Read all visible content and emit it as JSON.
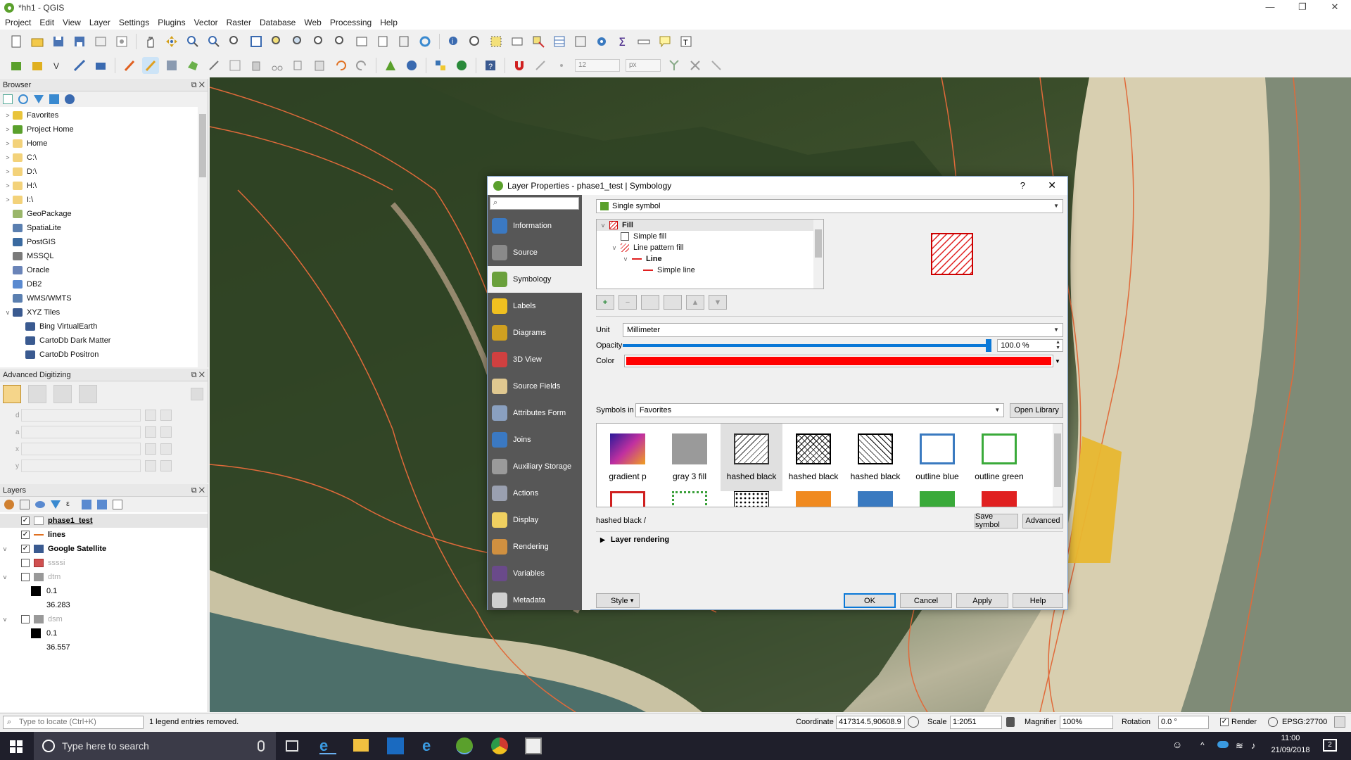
{
  "window": {
    "title": "*hh1 - QGIS",
    "minimize": "—",
    "restore": "❐",
    "close": "✕"
  },
  "menu": [
    "Project",
    "Edit",
    "View",
    "Layer",
    "Settings",
    "Plugins",
    "Vector",
    "Raster",
    "Database",
    "Web",
    "Processing",
    "Help"
  ],
  "toolbar2": {
    "snap_tolerance": "12",
    "snap_unit": "px"
  },
  "browser": {
    "title": "Browser",
    "items": [
      {
        "label": "Favorites",
        "icon": "star-icon",
        "color": "#e9c43b"
      },
      {
        "label": "Project Home",
        "icon": "folder-icon",
        "color": "#5aa02c"
      },
      {
        "label": "Home",
        "icon": "folder-icon",
        "color": "#f3d27a"
      },
      {
        "label": "C:\\",
        "icon": "folder-icon",
        "color": "#f3d27a"
      },
      {
        "label": "D:\\",
        "icon": "folder-icon",
        "color": "#f3d27a"
      },
      {
        "label": "H:\\",
        "icon": "folder-icon",
        "color": "#f3d27a"
      },
      {
        "label": "I:\\",
        "icon": "folder-icon",
        "color": "#f3d27a"
      },
      {
        "label": "GeoPackage",
        "icon": "geopackage-icon",
        "color": "#9ab66a"
      },
      {
        "label": "SpatiaLite",
        "icon": "spatialite-icon",
        "color": "#5a7fb0"
      },
      {
        "label": "PostGIS",
        "icon": "postgis-icon",
        "color": "#3a6aa0"
      },
      {
        "label": "MSSQL",
        "icon": "mssql-icon",
        "color": "#7a7a7a"
      },
      {
        "label": "Oracle",
        "icon": "oracle-icon",
        "color": "#6a84b8"
      },
      {
        "label": "DB2",
        "icon": "db2-icon",
        "color": "#5a8ad0"
      },
      {
        "label": "WMS/WMTS",
        "icon": "wms-icon",
        "color": "#5a7fb0"
      },
      {
        "label": "XYZ Tiles",
        "icon": "xyz-icon",
        "color": "#3a5a90"
      },
      {
        "label": "Bing VirtualEarth",
        "icon": "tile-icon",
        "color": "#3a5a90"
      },
      {
        "label": "CartoDb Dark Matter",
        "icon": "tile-icon",
        "color": "#3a5a90"
      },
      {
        "label": "CartoDb Positron",
        "icon": "tile-icon",
        "color": "#3a5a90"
      }
    ]
  },
  "advdig": {
    "title": "Advanced Digitizing",
    "rows": [
      "d",
      "a",
      "x",
      "y"
    ]
  },
  "layers": {
    "title": "Layers",
    "items": [
      {
        "label": "phase1_test",
        "checked": "✓",
        "bold": true
      },
      {
        "label": "lines",
        "checked": "✓",
        "bold": true
      },
      {
        "label": "Google Satellite",
        "checked": "✓",
        "bold": true
      },
      {
        "label": "ssssi",
        "checked": "",
        "bold": false
      },
      {
        "label": "dtm",
        "checked": "",
        "bold": false
      },
      {
        "label": "0.1",
        "checked": "",
        "bold": false
      },
      {
        "label": "36.283",
        "checked": "",
        "bold": false
      },
      {
        "label": "dsm",
        "checked": "",
        "bold": false
      },
      {
        "label": "0.1",
        "checked": "",
        "bold": false
      },
      {
        "label": "36.557",
        "checked": "",
        "bold": false
      }
    ]
  },
  "dialog": {
    "title": "Layer Properties - phase1_test | Symbology",
    "help": "?",
    "close": "✕",
    "nav": [
      {
        "label": "Information",
        "icon": "information-icon",
        "color": "#3b79c2"
      },
      {
        "label": "Source",
        "icon": "source-icon",
        "color": "#8a8a8a"
      },
      {
        "label": "Symbology",
        "icon": "symbology-icon",
        "color": "#6aa03c"
      },
      {
        "label": "Labels",
        "icon": "labels-icon",
        "color": "#f0c020"
      },
      {
        "label": "Diagrams",
        "icon": "diagrams-icon",
        "color": "#d0a020"
      },
      {
        "label": "3D View",
        "icon": "3d-view-icon",
        "color": "#d04040"
      },
      {
        "label": "Source Fields",
        "icon": "source-fields-icon",
        "color": "#e0c890"
      },
      {
        "label": "Attributes Form",
        "icon": "attributes-form-icon",
        "color": "#8aa0c0"
      },
      {
        "label": "Joins",
        "icon": "joins-icon",
        "color": "#3b79c2"
      },
      {
        "label": "Auxiliary Storage",
        "icon": "auxiliary-storage-icon",
        "color": "#9a9a9a"
      },
      {
        "label": "Actions",
        "icon": "actions-icon",
        "color": "#9aa0b0"
      },
      {
        "label": "Display",
        "icon": "display-icon",
        "color": "#f0d060"
      },
      {
        "label": "Rendering",
        "icon": "rendering-icon",
        "color": "#d09040"
      },
      {
        "label": "Variables",
        "icon": "variables-icon",
        "color": "#6a4a8a"
      },
      {
        "label": "Metadata",
        "icon": "metadata-icon",
        "color": "#d0d0d0"
      }
    ],
    "renderer": "Single symbol",
    "tree": [
      {
        "label": "Fill",
        "indent": 0,
        "arrow": "v",
        "bold": true
      },
      {
        "label": "Simple fill",
        "indent": 1,
        "arrow": "",
        "bold": false
      },
      {
        "label": "Line pattern fill",
        "indent": 1,
        "arrow": "v",
        "bold": false
      },
      {
        "label": "Line",
        "indent": 2,
        "arrow": "v",
        "bold": true
      },
      {
        "label": "Simple line",
        "indent": 3,
        "arrow": "",
        "bold": false
      }
    ],
    "unit_label": "Unit",
    "unit_value": "Millimeter",
    "opacity_label": "Opacity",
    "opacity_value": "100.0 %",
    "opacity_level": 1.0,
    "color_label": "Color",
    "color_value": "#ff0000",
    "symbols_in_label": "Symbols in",
    "symbols_in_value": "Favorites",
    "open_library": "Open Library",
    "symbols": [
      {
        "label": "gradient p"
      },
      {
        "label": "gray 3 fill"
      },
      {
        "label": "hashed black"
      },
      {
        "label": "hashed black"
      },
      {
        "label": "hashed black"
      },
      {
        "label": "outline blue"
      },
      {
        "label": "outline green"
      }
    ],
    "selected_symbol_name": "hashed black /",
    "save_symbol": "Save symbol",
    "advanced": "Advanced",
    "layer_rendering": "Layer rendering",
    "style": "Style",
    "ok": "OK",
    "cancel": "Cancel",
    "apply": "Apply",
    "help_btn": "Help"
  },
  "status": {
    "locate_placeholder": "Type to locate (Ctrl+K)",
    "message": "1 legend entries removed.",
    "coordinate_label": "Coordinate",
    "coordinate_value": "417314.5,90608.9",
    "scale_label": "Scale",
    "scale_value": "1:2051",
    "magnifier_label": "Magnifier",
    "magnifier_value": "100%",
    "rotation_label": "Rotation",
    "rotation_value": "0.0 °",
    "render_label": "Render",
    "crs": "EPSG:27700"
  },
  "taskbar": {
    "search_placeholder": "Type here to search",
    "time": "11:00",
    "date": "21/09/2018",
    "notifications": "2"
  }
}
